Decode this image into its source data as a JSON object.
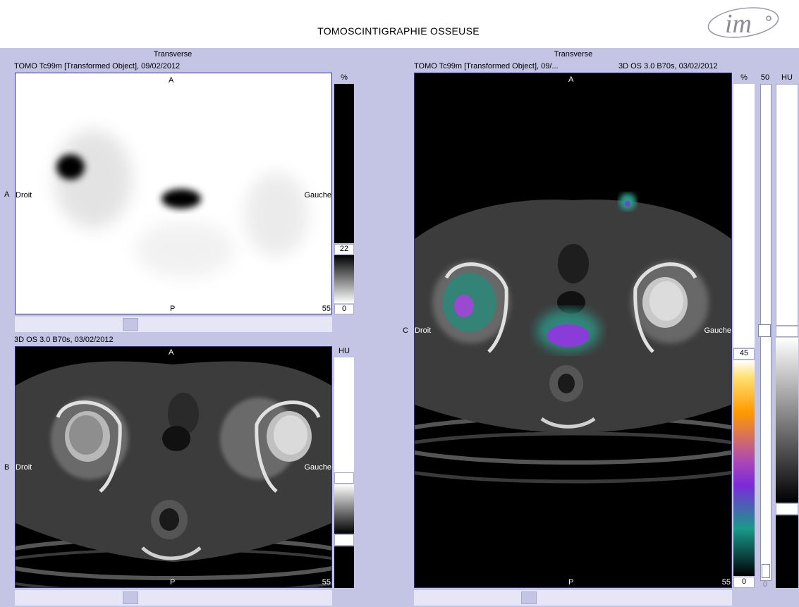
{
  "header": {
    "title": "TOMOSCINTIGRAPHIE OSSEUSE",
    "logo": "im"
  },
  "panel_a": {
    "view_title": "Transverse",
    "series": "TOMO Tc99m [Transformed Object], 09/02/2012",
    "row_letter": "A",
    "top": "A",
    "bottom": "P",
    "left": "Droit",
    "right": "Gauche",
    "slice": "55",
    "scale_unit": "%",
    "scale_max": "22",
    "scale_min": "0"
  },
  "panel_b": {
    "series": "3D OS  3.0  B70s, 03/02/2012",
    "row_letter": "B",
    "top": "A",
    "bottom": "P",
    "left": "Droit",
    "right": "Gauche",
    "slice": "55",
    "scale_unit": "HU"
  },
  "panel_c": {
    "view_title": "Transverse",
    "series_left": "TOMO Tc99m [Transformed Object], 09/...",
    "series_right": "3D OS  3.0  B70s, 03/02/2012",
    "row_letter": "C",
    "top": "A",
    "bottom": "P",
    "left": "Droit",
    "right": "Gauche",
    "slice": "55",
    "pct_unit": "%",
    "pct_top": "45",
    "pct_min": "0",
    "blend_max": "50",
    "blend_min": "0",
    "hu_unit": "HU"
  },
  "colors": {
    "background": "#c4c4e4",
    "viewport_border": "#2c2c8a",
    "scrollbar": "#e6e6f6"
  }
}
